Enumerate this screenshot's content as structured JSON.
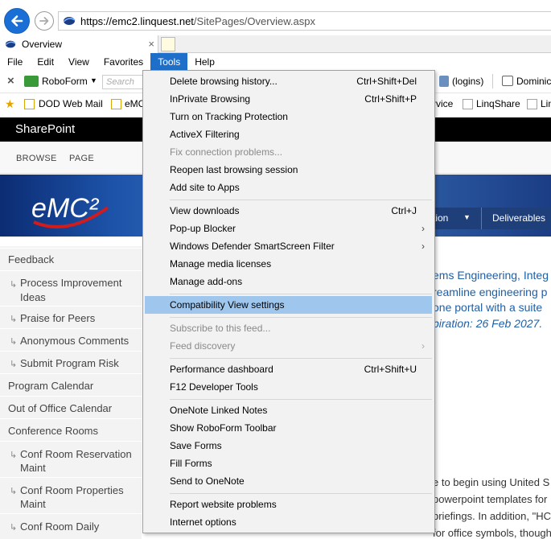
{
  "browser": {
    "url_host": "https://emc2.linquest.net",
    "url_path": "/SitePages/Overview.aspx",
    "tab_title": "Overview",
    "tab_close": "×",
    "menu": [
      "File",
      "Edit",
      "View",
      "Favorites",
      "Tools",
      "Help"
    ],
    "toolbar": {
      "close": "×",
      "roboform": "RoboForm",
      "roboform_caret": "▼",
      "search_placeholder": "Search",
      "logins": "(logins)",
      "dominic": "Dominic"
    },
    "favorites": [
      {
        "label": "DOD Web Mail"
      },
      {
        "label": "eMC"
      },
      {
        "label": "rvice"
      },
      {
        "label": "LinqShare"
      },
      {
        "label": "Lin"
      }
    ]
  },
  "sharepoint": {
    "title": "SharePoint",
    "ribbon_tabs": [
      "BROWSE",
      "PAGE"
    ],
    "logo": "eMC²",
    "nav_items": [
      {
        "label": "tion",
        "caret": "▼"
      },
      {
        "label": "Deliverables"
      }
    ]
  },
  "leftnav": [
    {
      "label": "Feedback",
      "level": "top"
    },
    {
      "label": "Process Improvement Ideas",
      "level": "sub"
    },
    {
      "label": "Praise for Peers",
      "level": "sub"
    },
    {
      "label": "Anonymous Comments",
      "level": "sub"
    },
    {
      "label": "Submit Program Risk",
      "level": "sub"
    },
    {
      "label": "Program Calendar",
      "level": "top"
    },
    {
      "label": "Out of Office Calendar",
      "level": "top"
    },
    {
      "label": "Conference Rooms",
      "level": "top"
    },
    {
      "label": "Conf Room Reservation Maint",
      "level": "sub"
    },
    {
      "label": "Conf Room Properties Maint",
      "level": "sub"
    },
    {
      "label": "Conf Room Daily",
      "level": "sub"
    }
  ],
  "content": {
    "blue_line1": "ems Engineering, Integ",
    "blue_line2": "reamline engineering p",
    "blue_line3": "one portal with a suite",
    "italic_line": "piration: 26 Feb 2027.",
    "dark_line1": "e to begin using United S",
    "dark_line2": "powerpoint templates for",
    "dark_line3": "briefings. In addition, \"HC",
    "dark_line4": "for office symbols, though \"U"
  },
  "tools_menu": {
    "groups": [
      [
        {
          "label": "Delete browsing history...",
          "shortcut": "Ctrl+Shift+Del"
        },
        {
          "label": "InPrivate Browsing",
          "shortcut": "Ctrl+Shift+P"
        },
        {
          "label": "Turn on Tracking Protection"
        },
        {
          "label": "ActiveX Filtering"
        },
        {
          "label": "Fix connection problems...",
          "disabled": true
        },
        {
          "label": "Reopen last browsing session"
        },
        {
          "label": "Add site to Apps"
        }
      ],
      [
        {
          "label": "View downloads",
          "shortcut": "Ctrl+J"
        },
        {
          "label": "Pop-up Blocker",
          "submenu": "›"
        },
        {
          "label": "Windows Defender SmartScreen Filter",
          "submenu": "›"
        },
        {
          "label": "Manage media licenses"
        },
        {
          "label": "Manage add-ons"
        }
      ],
      [
        {
          "label": "Compatibility View settings",
          "highlight": true
        }
      ],
      [
        {
          "label": "Subscribe to this feed...",
          "disabled": true
        },
        {
          "label": "Feed discovery",
          "disabled": true,
          "submenu": "›"
        }
      ],
      [
        {
          "label": "Performance dashboard",
          "shortcut": "Ctrl+Shift+U"
        },
        {
          "label": "F12 Developer Tools"
        }
      ],
      [
        {
          "label": "OneNote Linked Notes"
        },
        {
          "label": "Show RoboForm Toolbar"
        },
        {
          "label": "Save Forms"
        },
        {
          "label": "Fill Forms"
        },
        {
          "label": "Send to OneNote"
        }
      ],
      [
        {
          "label": "Report website problems"
        },
        {
          "label": "Internet options"
        }
      ]
    ]
  },
  "colors": {
    "menu_active": "#1e6fc9",
    "highlight": "#9fc6ec",
    "sp_bar": "#000000",
    "link_blue": "#1e5fa8"
  }
}
